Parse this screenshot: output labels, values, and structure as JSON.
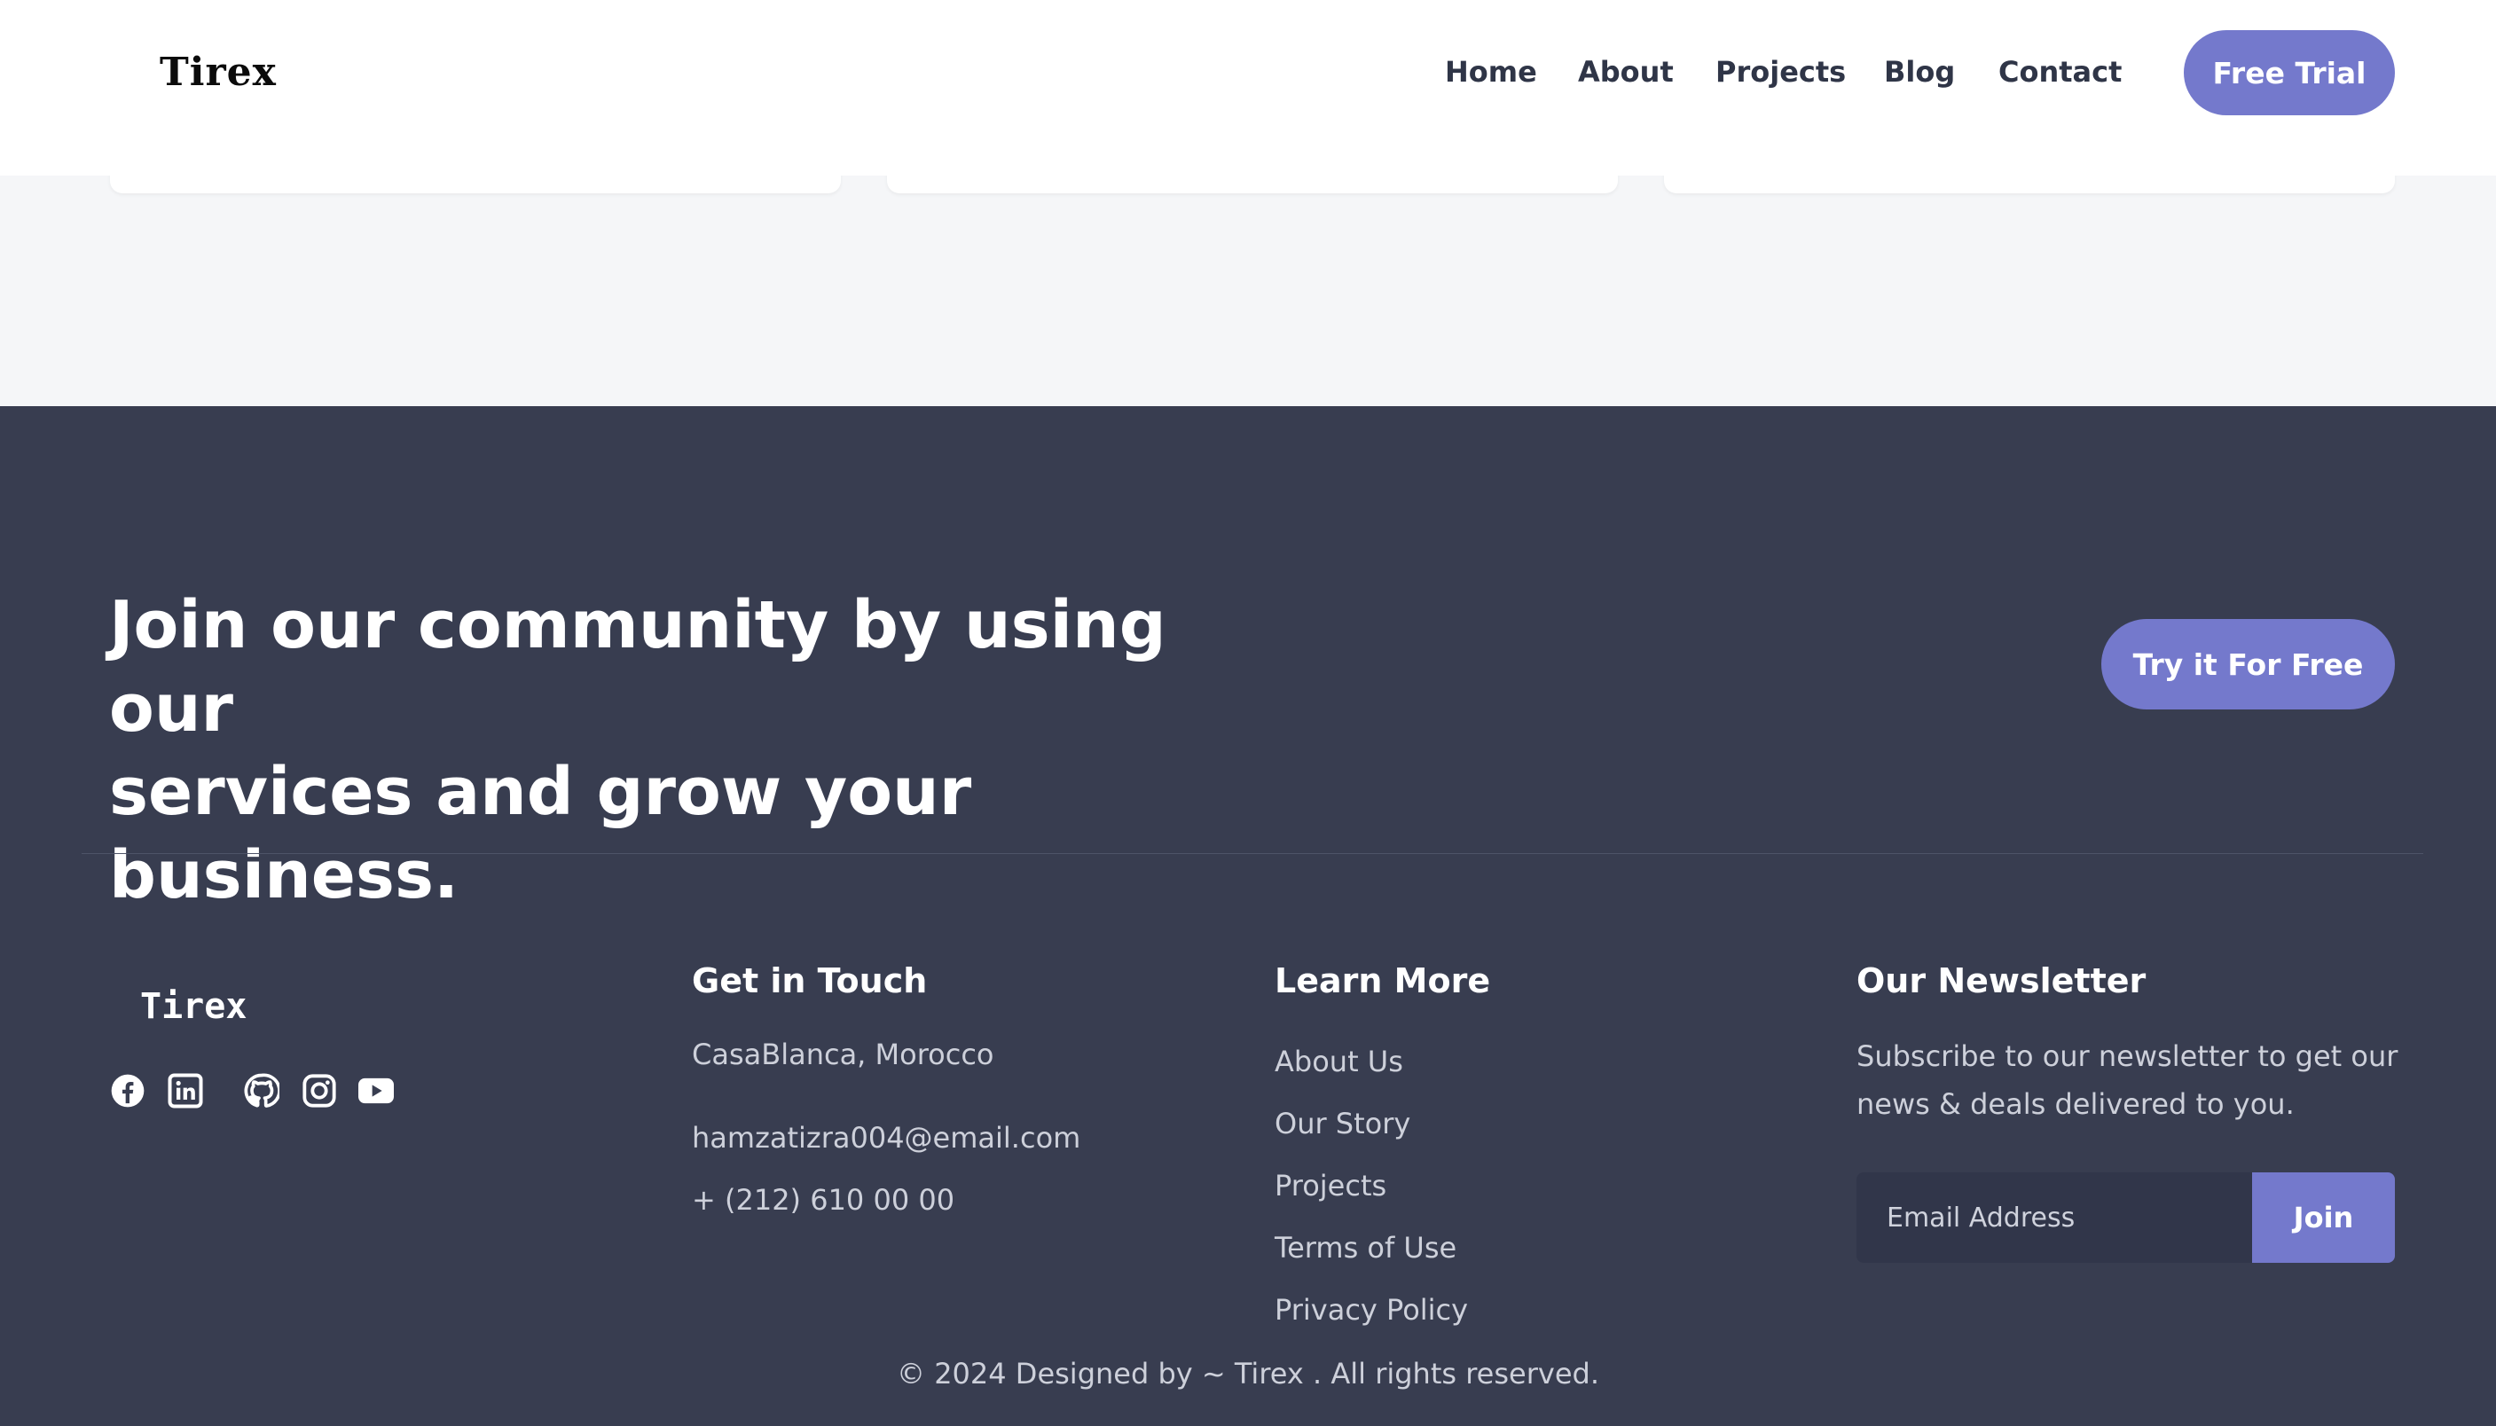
{
  "header": {
    "logo": "Tirex",
    "nav": [
      "Home",
      "About",
      "Projects",
      "Blog",
      "Contact"
    ],
    "cta_label": "Free Trial"
  },
  "cta": {
    "title_line1": "Join our community by using our",
    "title_line2": "services and grow your business.",
    "button_label": "Try it For Free"
  },
  "footer": {
    "logo": "Tirex",
    "social_icons": [
      "facebook-icon",
      "linkedin-icon",
      "github-icon",
      "instagram-icon",
      "youtube-icon"
    ],
    "contact": {
      "title": "Get in Touch",
      "location": "CasaBlanca, Morocco",
      "email": "hamzatizra004@email.com",
      "phone": "+ (212) 610 00 00"
    },
    "learn_more": {
      "title": "Learn More",
      "links": [
        "About Us",
        "Our Story",
        "Projects",
        "Terms of Use",
        "Privacy Policy"
      ]
    },
    "newsletter": {
      "title": "Our Newsletter",
      "text": "Subscribe to our newsletter to get our news & deals delivered to you.",
      "placeholder": "Email Address",
      "button_label": "Join"
    },
    "copyright": "© 2024 Designed by ~ Tirex . All rights reserved."
  },
  "colors": {
    "accent": "#7479cc",
    "footer_bg": "#383d50",
    "page_bg": "#f5f6f8",
    "nav_text": "#2f3547"
  }
}
